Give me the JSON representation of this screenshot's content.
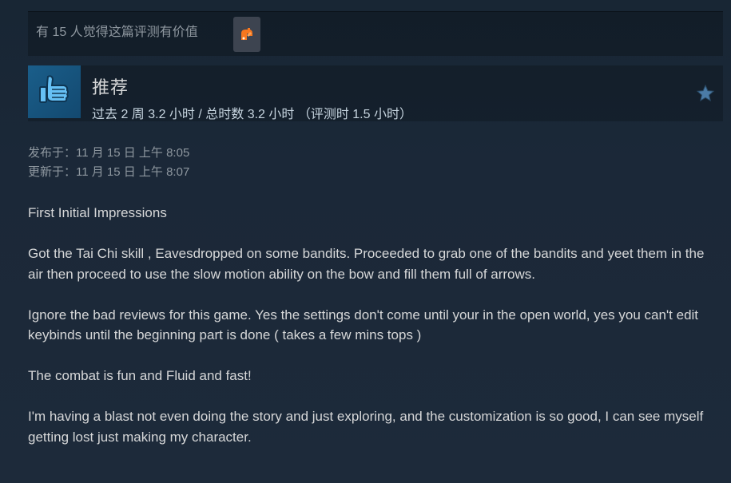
{
  "helpful": {
    "text": "有 15 人觉得这篇评测有价值"
  },
  "review": {
    "recommendation": "推荐",
    "hours": "过去 2 周 3.2 小时 / 总时数 3.2 小时 （评测时 1.5 小时）",
    "posted": "发布于：11 月 15 日 上午 8:05",
    "updated": "更新于：11 月 15 日 上午 8:07",
    "paragraphs": [
      "First Initial Impressions",
      "Got the Tai Chi skill , Eavesdropped on some bandits. Proceeded to grab one of the bandits and yeet them in the air then proceed to use the slow motion ability on the bow and fill them full of arrows.",
      "Ignore the bad reviews for this game. Yes the settings don't come until your in the open world, yes you can't edit keybinds until the beginning part is done ( takes a few mins tops )",
      "The combat is fun and Fluid and fast!",
      "I'm having a blast not even doing the story and just exploring, and the customization is so good, I can see myself getting lost just making my character."
    ]
  },
  "icons": {
    "award": "award-icon",
    "thumb": "thumbs-up-icon",
    "star": "star-icon"
  },
  "colors": {
    "background": "#1b2838",
    "thumb_box": "#1a5e8a",
    "award_orange": "#f7771e",
    "star": "#4b7ba6"
  }
}
